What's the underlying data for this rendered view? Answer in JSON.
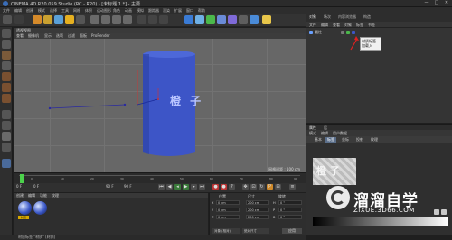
{
  "window": {
    "title": "CINEMA 4D R20.059 Studio (RC - R20) - [未标题 1 *] - 主要",
    "controls": [
      "—",
      "□",
      "✕"
    ]
  },
  "menubar": [
    "文件",
    "编辑",
    "创建",
    "模式",
    "选择",
    "工具",
    "网格",
    "体积",
    "运动图形",
    "角色",
    "动画",
    "模拟",
    "跟踪器",
    "渲染",
    "扩展",
    "窗口",
    "帮助"
  ],
  "viewport": {
    "header_label": "透视视图",
    "menu": [
      "查看",
      "摄像机",
      "显示",
      "选项",
      "过滤",
      "面板",
      "ProRender"
    ],
    "grid_label": "网格间距 : 100 cm",
    "decal_text": "橙 子"
  },
  "timeline": {
    "ticks": [
      "0",
      "10",
      "20",
      "30",
      "40",
      "50",
      "60",
      "70",
      "80",
      "90"
    ],
    "start": "0 F",
    "current": "0 F",
    "end": "90 F",
    "end2": "90 F",
    "frame": "0 F"
  },
  "material": {
    "menu": [
      "创建",
      "编辑",
      "功能",
      "纹理"
    ],
    "ball_label": "材质"
  },
  "coords": {
    "headers": [
      "位置",
      "尺寸",
      "旋转"
    ],
    "rows": [
      {
        "axis": "X",
        "pos": "0 cm",
        "size": "200 cm",
        "rot_axis": "H",
        "rot": "0 °"
      },
      {
        "axis": "Y",
        "pos": "0 cm",
        "size": "200 cm",
        "rot_axis": "P",
        "rot": "0 °"
      },
      {
        "axis": "Z",
        "pos": "0 cm",
        "size": "200 cm",
        "rot_axis": "B",
        "rot": "0 °"
      }
    ],
    "mode_1": "对象 (相对)",
    "mode_2": "绝对尺寸",
    "apply": "应用"
  },
  "statusbar": "材质标签 \"材质\" [材质]",
  "right_panel": {
    "tabs": [
      "对象",
      "场次",
      "内容浏览器",
      "构造"
    ],
    "obj_menu": [
      "文件",
      "编辑",
      "查看",
      "对象",
      "标签",
      "书签"
    ],
    "object_name": "圆柱",
    "callout": "材质标签\n加载入"
  },
  "attributes": {
    "tabs": [
      "属性",
      "层"
    ],
    "menu": [
      "模式",
      "编辑",
      "用户数据"
    ],
    "subtabs": [
      "基本",
      "标签",
      "坐标",
      "投射",
      "纹理"
    ],
    "active_subtab": "标签"
  },
  "watermark": {
    "title": "溜溜自学",
    "url": "ZIXUE.3D66.COM"
  },
  "colors": {
    "cylinder": "#3d55c7",
    "accent": "#d7a800",
    "marker": "#4bd14b"
  }
}
